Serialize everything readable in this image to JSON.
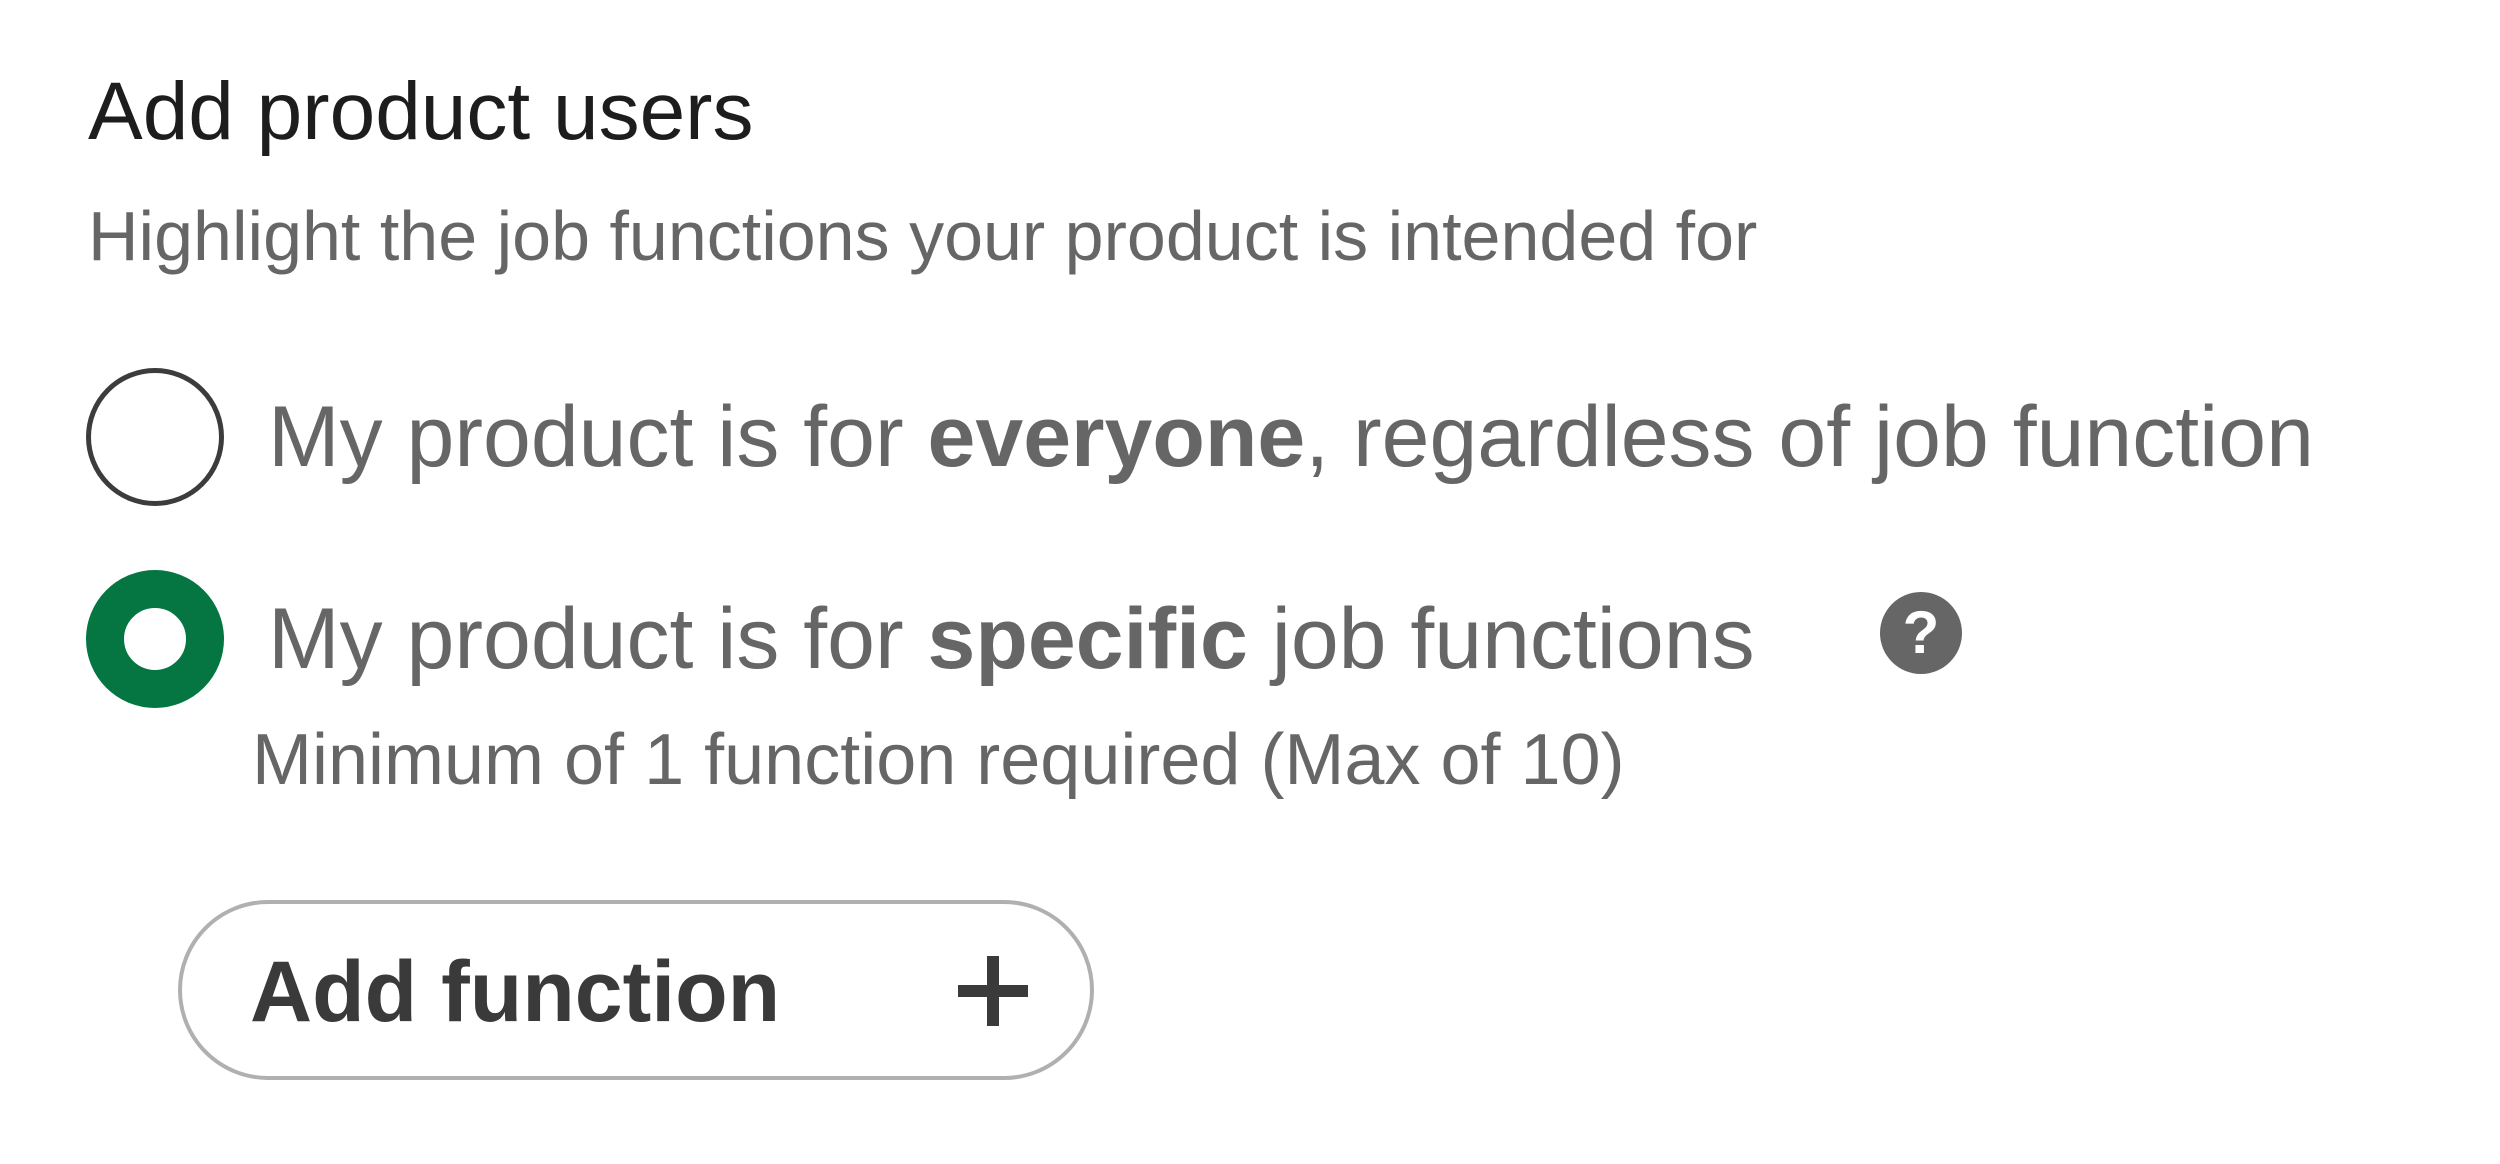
{
  "section": {
    "title": "Add product users",
    "subtitle": "Highlight the job functions your product is intended for"
  },
  "options": [
    {
      "id": "everyone",
      "prefix": "My product is for ",
      "emphasis": "everyone",
      "suffix": ", regardless of job function",
      "selected": false
    },
    {
      "id": "specific",
      "prefix": "My product is for ",
      "emphasis": "specific",
      "suffix": " job functions",
      "selected": true,
      "help_icon": "question-icon",
      "help_glyph": "?",
      "hint": "Minimum of 1 function required (Max of 10)"
    }
  ],
  "add_button": {
    "label": "Add function",
    "icon": "plus-icon"
  },
  "colors": {
    "accent": "#057642",
    "text_primary": "#1d1d1d",
    "text_secondary": "#666666",
    "button_border": "#b0b0b0"
  }
}
